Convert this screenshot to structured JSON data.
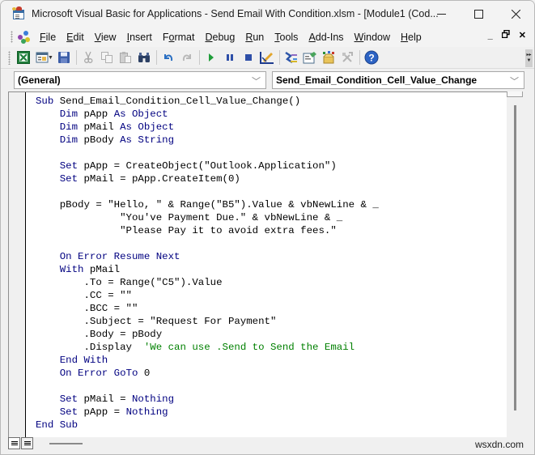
{
  "window": {
    "title": "Microsoft Visual Basic for Applications - Send Email With Condition.xlsm - [Module1 (Cod...",
    "controls": {
      "minimize": "minimize",
      "maximize": "maximize",
      "close": "close"
    }
  },
  "menubar": {
    "items": [
      {
        "label": "File",
        "accel": "F"
      },
      {
        "label": "Edit",
        "accel": "E"
      },
      {
        "label": "View",
        "accel": "V"
      },
      {
        "label": "Insert",
        "accel": "I"
      },
      {
        "label": "Format",
        "accel": "o"
      },
      {
        "label": "Debug",
        "accel": "D"
      },
      {
        "label": "Run",
        "accel": "R"
      },
      {
        "label": "Tools",
        "accel": "T"
      },
      {
        "label": "Add-Ins",
        "accel": "A"
      },
      {
        "label": "Window",
        "accel": "W"
      },
      {
        "label": "Help",
        "accel": "H"
      }
    ],
    "mdi_controls": {
      "minimize": "_",
      "restore": "🗗",
      "close": "✕"
    }
  },
  "toolbar": {
    "buttons": [
      "view-excel",
      "insert-module",
      "save",
      "cut",
      "copy",
      "paste",
      "find",
      "undo",
      "redo",
      "run",
      "break",
      "reset",
      "design-mode",
      "project-explorer",
      "properties-window",
      "object-browser",
      "toolbox",
      "help"
    ]
  },
  "combos": {
    "object": "(General)",
    "procedure": "Send_Email_Condition_Cell_Value_Change"
  },
  "code": {
    "lines": [
      [
        {
          "t": "Sub ",
          "k": 1
        },
        {
          "t": "Send_Email_Condition_Cell_Value_Change()"
        }
      ],
      [
        {
          "t": "    Dim ",
          "k": 1
        },
        {
          "t": "pApp "
        },
        {
          "t": "As Object",
          "k": 1
        }
      ],
      [
        {
          "t": "    Dim ",
          "k": 1
        },
        {
          "t": "pMail "
        },
        {
          "t": "As Object",
          "k": 1
        }
      ],
      [
        {
          "t": "    Dim ",
          "k": 1
        },
        {
          "t": "pBody "
        },
        {
          "t": "As String",
          "k": 1
        }
      ],
      [
        {
          "t": ""
        }
      ],
      [
        {
          "t": "    Set ",
          "k": 1
        },
        {
          "t": "pApp = CreateObject(\"Outlook.Application\")"
        }
      ],
      [
        {
          "t": "    Set ",
          "k": 1
        },
        {
          "t": "pMail = pApp.CreateItem(0)"
        }
      ],
      [
        {
          "t": ""
        }
      ],
      [
        {
          "t": "    pBody = \"Hello, \" & Range(\"B5\").Value & vbNewLine & _"
        }
      ],
      [
        {
          "t": "              \"You've Payment Due.\" & vbNewLine & _"
        }
      ],
      [
        {
          "t": "              \"Please Pay it to avoid extra fees.\""
        }
      ],
      [
        {
          "t": ""
        }
      ],
      [
        {
          "t": "    On Error Resume Next",
          "k": 1
        }
      ],
      [
        {
          "t": "    With ",
          "k": 1
        },
        {
          "t": "pMail"
        }
      ],
      [
        {
          "t": "        .To = Range(\"C5\").Value"
        }
      ],
      [
        {
          "t": "        .CC = \"\""
        }
      ],
      [
        {
          "t": "        .BCC = \"\""
        }
      ],
      [
        {
          "t": "        .Subject = \"Request For Payment\""
        }
      ],
      [
        {
          "t": "        .Body = pBody"
        }
      ],
      [
        {
          "t": "        .Display  "
        },
        {
          "t": "'We can use .Send to Send the Email",
          "c": 1
        }
      ],
      [
        {
          "t": "    End With",
          "k": 1
        }
      ],
      [
        {
          "t": "    On Error GoTo ",
          "k": 1
        },
        {
          "t": "0"
        }
      ],
      [
        {
          "t": ""
        }
      ],
      [
        {
          "t": "    Set ",
          "k": 1
        },
        {
          "t": "pMail = "
        },
        {
          "t": "Nothing",
          "k": 1
        }
      ],
      [
        {
          "t": "    Set ",
          "k": 1
        },
        {
          "t": "pApp = "
        },
        {
          "t": "Nothing",
          "k": 1
        }
      ],
      [
        {
          "t": "End Sub",
          "k": 1
        }
      ]
    ]
  },
  "colors": {
    "keyword": "#000080",
    "comment": "#008000",
    "identifier": "#000000"
  },
  "watermark": "wsxdn.com"
}
